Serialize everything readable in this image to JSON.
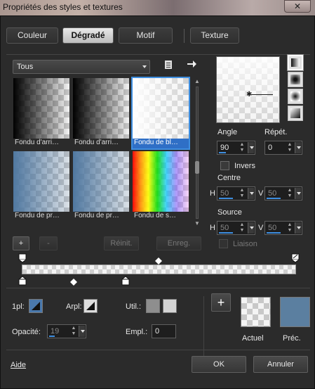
{
  "window": {
    "title": "Propriétés des styles et textures",
    "close_label": "✕"
  },
  "tabs": [
    {
      "label": "Couleur",
      "active": false
    },
    {
      "label": "Dégradé",
      "active": true
    },
    {
      "label": "Motif",
      "active": false
    },
    {
      "label": "Texture",
      "active": false
    }
  ],
  "category": {
    "selected": "Tous"
  },
  "gradients": [
    {
      "caption": "Fondu d'arri…",
      "kind": "black-fade",
      "selected": false
    },
    {
      "caption": "Fondu d'arri…",
      "kind": "black-fade",
      "selected": false
    },
    {
      "caption": "Fondu de bl…",
      "kind": "white-fade",
      "selected": true
    },
    {
      "caption": "Fondu de pr…",
      "kind": "blue-fade",
      "selected": false
    },
    {
      "caption": "Fondu de pr…",
      "kind": "blue-fade",
      "selected": false
    },
    {
      "caption": "Fondu de s…",
      "kind": "spectrum",
      "selected": false
    }
  ],
  "list_buttons": {
    "add": "+",
    "remove": "-",
    "reset": "Réinit.",
    "save": "Enreg."
  },
  "angle": {
    "label": "Angle",
    "value": "90",
    "fill": 0.25
  },
  "repeat": {
    "label": "Répét.",
    "value": "0"
  },
  "invert": {
    "label": "Invers",
    "checked": false
  },
  "center": {
    "label": "Centre",
    "h_label": "H",
    "h_value": "50",
    "v_label": "V",
    "v_value": "50"
  },
  "source": {
    "label": "Source",
    "h_label": "H",
    "h_value": "50",
    "v_label": "V",
    "v_value": "50"
  },
  "link": {
    "label": "Liaison",
    "checked": false
  },
  "controls": {
    "opacity_prefix": "1pl:",
    "arpl_label": "Arpl:",
    "util_label": "Util.:",
    "opacity_label": "Opacité:",
    "opacity_value": "19",
    "opacity_fill": 0.19,
    "empl_label": "Empl.:",
    "empl_value": "0",
    "util_colors": [
      "#8e8e8e",
      "#d4d4d4"
    ]
  },
  "current": {
    "label": "Actuel",
    "add": "+"
  },
  "previous": {
    "label": "Préc.",
    "color": "#5b7fa0"
  },
  "footer": {
    "help": "Aide",
    "ok": "OK",
    "cancel": "Annuler"
  }
}
